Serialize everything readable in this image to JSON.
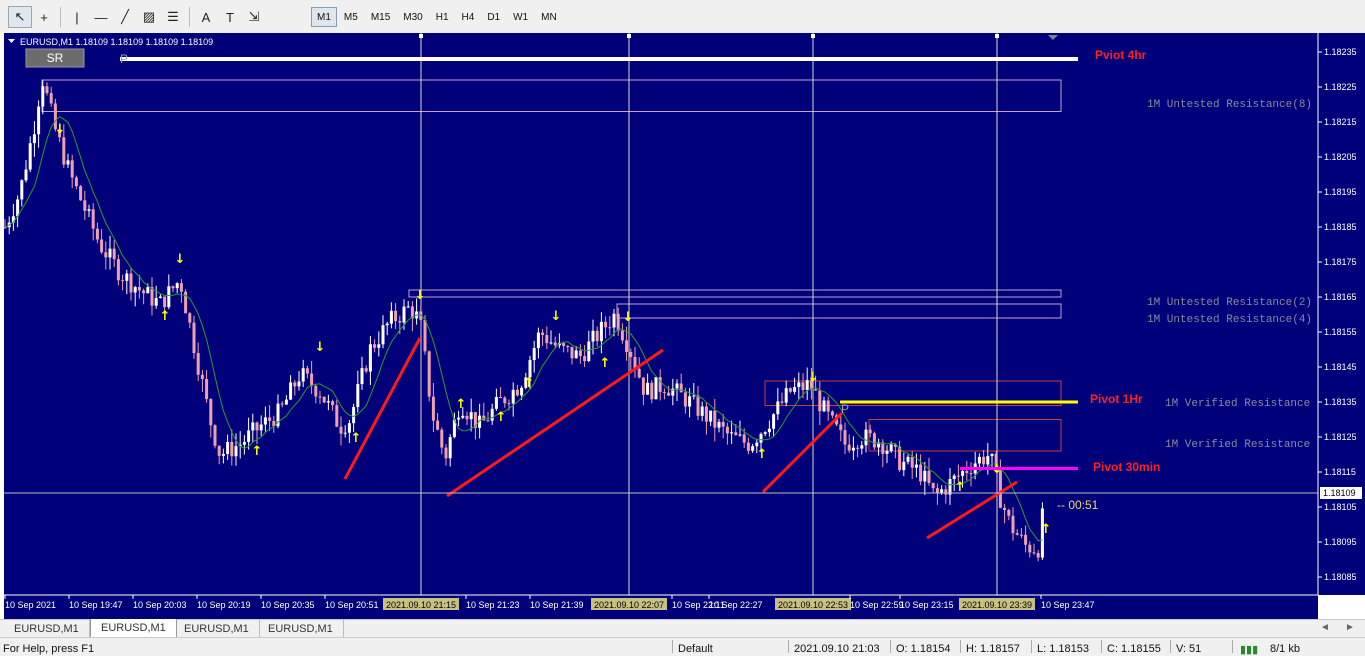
{
  "toolbar": {
    "tools": [
      {
        "name": "cursor-icon",
        "glyph": "↖",
        "active": true
      },
      {
        "name": "crosshair-icon",
        "glyph": "+",
        "active": false
      },
      {
        "name": "vertical-line-icon",
        "glyph": "|",
        "active": false
      },
      {
        "name": "horizontal-line-icon",
        "glyph": "—",
        "active": false
      },
      {
        "name": "trendline-icon",
        "glyph": "╱",
        "active": false
      },
      {
        "name": "channel-icon",
        "glyph": "▨",
        "active": false
      },
      {
        "name": "fibonacci-icon",
        "glyph": "☰",
        "active": false
      },
      {
        "name": "text-icon",
        "glyph": "A",
        "active": false
      },
      {
        "name": "text-label-icon",
        "glyph": "T",
        "active": false
      },
      {
        "name": "shapes-icon",
        "glyph": "⇲",
        "active": false
      }
    ],
    "timeframes": [
      {
        "label": "M1",
        "active": true
      },
      {
        "label": "M5",
        "active": false
      },
      {
        "label": "M15",
        "active": false
      },
      {
        "label": "M30",
        "active": false
      },
      {
        "label": "H1",
        "active": false
      },
      {
        "label": "H4",
        "active": false
      },
      {
        "label": "D1",
        "active": false
      },
      {
        "label": "W1",
        "active": false
      },
      {
        "label": "MN",
        "active": false
      }
    ]
  },
  "chart": {
    "header": "EURUSD,M1  1.18109 1.18109 1.18109 1.18109",
    "sr_button": "SR",
    "pivot_marker": "P",
    "current_price": "1.18109",
    "countdown": "00:51",
    "colors": {
      "background": "#00007b",
      "bull": "#ffffff",
      "bear": "#f0a0b0",
      "ma": "#2a9d2a",
      "arrow": "#ffff00",
      "trend": "#ff1a1a",
      "pivot_4hr": "#ffffff",
      "pivot_1hr": "#ffff00",
      "pivot_30min": "#ff00ff",
      "label_red": "#ff2020",
      "zone_text": "#8a8a9a"
    },
    "levels": [
      {
        "label": "Pviot 4hr",
        "price": 1.18233
      },
      {
        "label": "Pivot 1Hr",
        "price": 1.18135
      },
      {
        "label": "Pivot 30min",
        "price": 1.18116
      }
    ],
    "zones": [
      {
        "label": "1M Untested Resistance(8)",
        "price": 1.18225
      },
      {
        "label": "1M Untested Resistance(2)",
        "price": 1.18166
      },
      {
        "label": "1M Untested Resistance(4)",
        "price": 1.18161
      },
      {
        "label": "1M Verified Resistance",
        "price": 1.18134
      },
      {
        "label": "1M Verified Resistance",
        "price": 1.18122
      }
    ],
    "price_axis": [
      "1.18235",
      "1.18225",
      "1.18215",
      "1.18205",
      "1.18195",
      "1.18185",
      "1.18175",
      "1.18165",
      "1.18155",
      "1.18145",
      "1.18135",
      "1.18125",
      "1.18115",
      "1.18105",
      "1.18095",
      "1.18085"
    ],
    "time_axis": [
      "10 Sep 2021",
      "10 Sep 19:47",
      "10 Sep 20:03",
      "10 Sep 20:19",
      "10 Sep 20:35",
      "10 Sep 20:51",
      "10 Sep 21:23",
      "10 Sep 21:39",
      "10 Sep 22:11",
      "10 Sep 22:27",
      "10 Sep 22:59",
      "10 Sep 23:15",
      "10 Sep 23:47"
    ],
    "vline_labels": [
      "2021.09.10 21:15",
      "2021.09.10 22:07",
      "2021.09.10 22:53",
      "2021.09.10 23:39"
    ]
  },
  "tabs": [
    {
      "label": "EURUSD,M1",
      "active": false
    },
    {
      "label": "EURUSD,M1",
      "active": true
    },
    {
      "label": "EURUSD,M1",
      "active": false
    },
    {
      "label": "EURUSD,M1",
      "active": false
    }
  ],
  "status": {
    "help": "For Help, press F1",
    "profile": "Default",
    "datetime": "2021.09.10 21:03",
    "open": "O: 1.18154",
    "high": "H: 1.18157",
    "low": "L: 1.18153",
    "close": "C: 1.18155",
    "volume": "V: 51",
    "traffic": "8/1 kb"
  }
}
